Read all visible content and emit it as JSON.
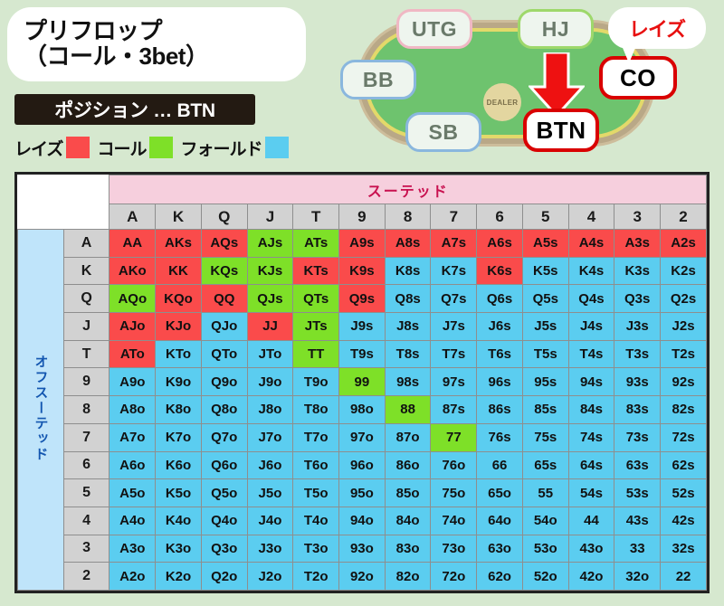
{
  "header": {
    "title_line1": "プリフロップ",
    "title_line2": "（コール・3bet）",
    "position_label": "ポジション … BTN"
  },
  "legend": {
    "items": [
      {
        "label": "レイズ",
        "color": "#fa4b4b",
        "action": "raise"
      },
      {
        "label": "コール",
        "color": "#7ee028",
        "action": "call"
      },
      {
        "label": "フォールド",
        "color": "#5bcdf0",
        "action": "fold"
      }
    ]
  },
  "table_diagram": {
    "seats": [
      {
        "name": "UTG",
        "border": "#f0b8c4"
      },
      {
        "name": "HJ",
        "border": "#9ed86b"
      },
      {
        "name": "CO",
        "border": "#d90000"
      },
      {
        "name": "BTN",
        "border": "#d90000"
      },
      {
        "name": "SB",
        "border": "#8ab7de"
      },
      {
        "name": "BB",
        "border": "#8ab7de"
      }
    ],
    "dealer_button": "DEALER",
    "raise_callout": "レイズ",
    "hero_seat": "BTN",
    "raiser_seat": "CO",
    "arrow_color": "#ee1111"
  },
  "grid": {
    "suited_banner": "スーテッド",
    "offsuit_banner": "オフスーテッド",
    "ranks": [
      "A",
      "K",
      "Q",
      "J",
      "T",
      "9",
      "8",
      "7",
      "6",
      "5",
      "4",
      "3",
      "2"
    ],
    "rows": [
      {
        "rank": "A",
        "cells": [
          {
            "t": "AA",
            "a": "raise"
          },
          {
            "t": "AKs",
            "a": "raise"
          },
          {
            "t": "AQs",
            "a": "raise"
          },
          {
            "t": "AJs",
            "a": "call"
          },
          {
            "t": "ATs",
            "a": "call"
          },
          {
            "t": "A9s",
            "a": "raise"
          },
          {
            "t": "A8s",
            "a": "raise"
          },
          {
            "t": "A7s",
            "a": "raise"
          },
          {
            "t": "A6s",
            "a": "raise"
          },
          {
            "t": "A5s",
            "a": "raise"
          },
          {
            "t": "A4s",
            "a": "raise"
          },
          {
            "t": "A3s",
            "a": "raise"
          },
          {
            "t": "A2s",
            "a": "raise"
          }
        ]
      },
      {
        "rank": "K",
        "cells": [
          {
            "t": "AKo",
            "a": "raise"
          },
          {
            "t": "KK",
            "a": "raise"
          },
          {
            "t": "KQs",
            "a": "call"
          },
          {
            "t": "KJs",
            "a": "call"
          },
          {
            "t": "KTs",
            "a": "raise"
          },
          {
            "t": "K9s",
            "a": "raise"
          },
          {
            "t": "K8s",
            "a": "fold"
          },
          {
            "t": "K7s",
            "a": "fold"
          },
          {
            "t": "K6s",
            "a": "raise"
          },
          {
            "t": "K5s",
            "a": "fold"
          },
          {
            "t": "K4s",
            "a": "fold"
          },
          {
            "t": "K3s",
            "a": "fold"
          },
          {
            "t": "K2s",
            "a": "fold"
          }
        ]
      },
      {
        "rank": "Q",
        "cells": [
          {
            "t": "AQo",
            "a": "call"
          },
          {
            "t": "KQo",
            "a": "raise"
          },
          {
            "t": "QQ",
            "a": "raise"
          },
          {
            "t": "QJs",
            "a": "call"
          },
          {
            "t": "QTs",
            "a": "call"
          },
          {
            "t": "Q9s",
            "a": "raise"
          },
          {
            "t": "Q8s",
            "a": "fold"
          },
          {
            "t": "Q7s",
            "a": "fold"
          },
          {
            "t": "Q6s",
            "a": "fold"
          },
          {
            "t": "Q5s",
            "a": "fold"
          },
          {
            "t": "Q4s",
            "a": "fold"
          },
          {
            "t": "Q3s",
            "a": "fold"
          },
          {
            "t": "Q2s",
            "a": "fold"
          }
        ]
      },
      {
        "rank": "J",
        "cells": [
          {
            "t": "AJo",
            "a": "raise"
          },
          {
            "t": "KJo",
            "a": "raise"
          },
          {
            "t": "QJo",
            "a": "fold"
          },
          {
            "t": "JJ",
            "a": "raise"
          },
          {
            "t": "JTs",
            "a": "call"
          },
          {
            "t": "J9s",
            "a": "fold"
          },
          {
            "t": "J8s",
            "a": "fold"
          },
          {
            "t": "J7s",
            "a": "fold"
          },
          {
            "t": "J6s",
            "a": "fold"
          },
          {
            "t": "J5s",
            "a": "fold"
          },
          {
            "t": "J4s",
            "a": "fold"
          },
          {
            "t": "J3s",
            "a": "fold"
          },
          {
            "t": "J2s",
            "a": "fold"
          }
        ]
      },
      {
        "rank": "T",
        "cells": [
          {
            "t": "ATo",
            "a": "raise"
          },
          {
            "t": "KTo",
            "a": "fold"
          },
          {
            "t": "QTo",
            "a": "fold"
          },
          {
            "t": "JTo",
            "a": "fold"
          },
          {
            "t": "TT",
            "a": "call"
          },
          {
            "t": "T9s",
            "a": "fold"
          },
          {
            "t": "T8s",
            "a": "fold"
          },
          {
            "t": "T7s",
            "a": "fold"
          },
          {
            "t": "T6s",
            "a": "fold"
          },
          {
            "t": "T5s",
            "a": "fold"
          },
          {
            "t": "T4s",
            "a": "fold"
          },
          {
            "t": "T3s",
            "a": "fold"
          },
          {
            "t": "T2s",
            "a": "fold"
          }
        ]
      },
      {
        "rank": "9",
        "cells": [
          {
            "t": "A9o",
            "a": "fold"
          },
          {
            "t": "K9o",
            "a": "fold"
          },
          {
            "t": "Q9o",
            "a": "fold"
          },
          {
            "t": "J9o",
            "a": "fold"
          },
          {
            "t": "T9o",
            "a": "fold"
          },
          {
            "t": "99",
            "a": "call"
          },
          {
            "t": "98s",
            "a": "fold"
          },
          {
            "t": "97s",
            "a": "fold"
          },
          {
            "t": "96s",
            "a": "fold"
          },
          {
            "t": "95s",
            "a": "fold"
          },
          {
            "t": "94s",
            "a": "fold"
          },
          {
            "t": "93s",
            "a": "fold"
          },
          {
            "t": "92s",
            "a": "fold"
          }
        ]
      },
      {
        "rank": "8",
        "cells": [
          {
            "t": "A8o",
            "a": "fold"
          },
          {
            "t": "K8o",
            "a": "fold"
          },
          {
            "t": "Q8o",
            "a": "fold"
          },
          {
            "t": "J8o",
            "a": "fold"
          },
          {
            "t": "T8o",
            "a": "fold"
          },
          {
            "t": "98o",
            "a": "fold"
          },
          {
            "t": "88",
            "a": "call"
          },
          {
            "t": "87s",
            "a": "fold"
          },
          {
            "t": "86s",
            "a": "fold"
          },
          {
            "t": "85s",
            "a": "fold"
          },
          {
            "t": "84s",
            "a": "fold"
          },
          {
            "t": "83s",
            "a": "fold"
          },
          {
            "t": "82s",
            "a": "fold"
          }
        ]
      },
      {
        "rank": "7",
        "cells": [
          {
            "t": "A7o",
            "a": "fold"
          },
          {
            "t": "K7o",
            "a": "fold"
          },
          {
            "t": "Q7o",
            "a": "fold"
          },
          {
            "t": "J7o",
            "a": "fold"
          },
          {
            "t": "T7o",
            "a": "fold"
          },
          {
            "t": "97o",
            "a": "fold"
          },
          {
            "t": "87o",
            "a": "fold"
          },
          {
            "t": "77",
            "a": "call"
          },
          {
            "t": "76s",
            "a": "fold"
          },
          {
            "t": "75s",
            "a": "fold"
          },
          {
            "t": "74s",
            "a": "fold"
          },
          {
            "t": "73s",
            "a": "fold"
          },
          {
            "t": "72s",
            "a": "fold"
          }
        ]
      },
      {
        "rank": "6",
        "cells": [
          {
            "t": "A6o",
            "a": "fold"
          },
          {
            "t": "K6o",
            "a": "fold"
          },
          {
            "t": "Q6o",
            "a": "fold"
          },
          {
            "t": "J6o",
            "a": "fold"
          },
          {
            "t": "T6o",
            "a": "fold"
          },
          {
            "t": "96o",
            "a": "fold"
          },
          {
            "t": "86o",
            "a": "fold"
          },
          {
            "t": "76o",
            "a": "fold"
          },
          {
            "t": "66",
            "a": "fold"
          },
          {
            "t": "65s",
            "a": "fold"
          },
          {
            "t": "64s",
            "a": "fold"
          },
          {
            "t": "63s",
            "a": "fold"
          },
          {
            "t": "62s",
            "a": "fold"
          }
        ]
      },
      {
        "rank": "5",
        "cells": [
          {
            "t": "A5o",
            "a": "fold"
          },
          {
            "t": "K5o",
            "a": "fold"
          },
          {
            "t": "Q5o",
            "a": "fold"
          },
          {
            "t": "J5o",
            "a": "fold"
          },
          {
            "t": "T5o",
            "a": "fold"
          },
          {
            "t": "95o",
            "a": "fold"
          },
          {
            "t": "85o",
            "a": "fold"
          },
          {
            "t": "75o",
            "a": "fold"
          },
          {
            "t": "65o",
            "a": "fold"
          },
          {
            "t": "55",
            "a": "fold"
          },
          {
            "t": "54s",
            "a": "fold"
          },
          {
            "t": "53s",
            "a": "fold"
          },
          {
            "t": "52s",
            "a": "fold"
          }
        ]
      },
      {
        "rank": "4",
        "cells": [
          {
            "t": "A4o",
            "a": "fold"
          },
          {
            "t": "K4o",
            "a": "fold"
          },
          {
            "t": "Q4o",
            "a": "fold"
          },
          {
            "t": "J4o",
            "a": "fold"
          },
          {
            "t": "T4o",
            "a": "fold"
          },
          {
            "t": "94o",
            "a": "fold"
          },
          {
            "t": "84o",
            "a": "fold"
          },
          {
            "t": "74o",
            "a": "fold"
          },
          {
            "t": "64o",
            "a": "fold"
          },
          {
            "t": "54o",
            "a": "fold"
          },
          {
            "t": "44",
            "a": "fold"
          },
          {
            "t": "43s",
            "a": "fold"
          },
          {
            "t": "42s",
            "a": "fold"
          }
        ]
      },
      {
        "rank": "3",
        "cells": [
          {
            "t": "A3o",
            "a": "fold"
          },
          {
            "t": "K3o",
            "a": "fold"
          },
          {
            "t": "Q3o",
            "a": "fold"
          },
          {
            "t": "J3o",
            "a": "fold"
          },
          {
            "t": "T3o",
            "a": "fold"
          },
          {
            "t": "93o",
            "a": "fold"
          },
          {
            "t": "83o",
            "a": "fold"
          },
          {
            "t": "73o",
            "a": "fold"
          },
          {
            "t": "63o",
            "a": "fold"
          },
          {
            "t": "53o",
            "a": "fold"
          },
          {
            "t": "43o",
            "a": "fold"
          },
          {
            "t": "33",
            "a": "fold"
          },
          {
            "t": "32s",
            "a": "fold"
          }
        ]
      },
      {
        "rank": "2",
        "cells": [
          {
            "t": "A2o",
            "a": "fold"
          },
          {
            "t": "K2o",
            "a": "fold"
          },
          {
            "t": "Q2o",
            "a": "fold"
          },
          {
            "t": "J2o",
            "a": "fold"
          },
          {
            "t": "T2o",
            "a": "fold"
          },
          {
            "t": "92o",
            "a": "fold"
          },
          {
            "t": "82o",
            "a": "fold"
          },
          {
            "t": "72o",
            "a": "fold"
          },
          {
            "t": "62o",
            "a": "fold"
          },
          {
            "t": "52o",
            "a": "fold"
          },
          {
            "t": "42o",
            "a": "fold"
          },
          {
            "t": "32o",
            "a": "fold"
          },
          {
            "t": "22",
            "a": "fold"
          }
        ]
      }
    ]
  }
}
